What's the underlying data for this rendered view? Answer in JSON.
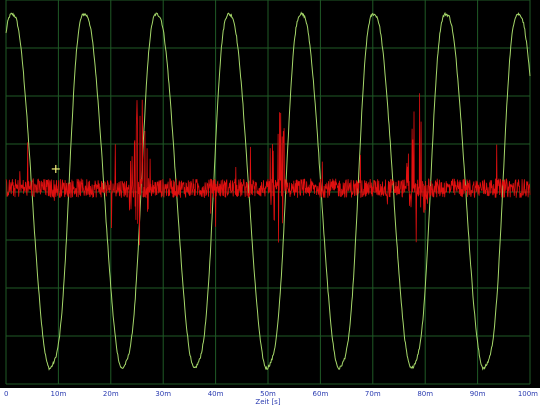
{
  "chart_data": {
    "type": "line",
    "background": "#000000",
    "grid": true,
    "grid_color": "#1f5a26",
    "xlabel": "Zeit [s]",
    "xlim": [
      0,
      0.1
    ],
    "x_tick_values": [
      0,
      0.01,
      0.02,
      0.03,
      0.04,
      0.05,
      0.06,
      0.07,
      0.08,
      0.09,
      0.1
    ],
    "x_tick_labels": [
      "0",
      "10m",
      "20m",
      "30m",
      "40m",
      "50m",
      "60m",
      "70m",
      "80m",
      "90m",
      "100m"
    ],
    "ylim": [
      -1.0,
      1.0
    ],
    "y_grid_lines": 8,
    "series": [
      {
        "color": "#a6d86a",
        "style": "sine-like",
        "period": 0.0138,
        "amplitude": 0.92,
        "phase_peak_at": 0.0015
      },
      {
        "color": "#e01010",
        "style": "noise with spike bursts",
        "baseline": 0.02,
        "noise_amplitude": 0.05,
        "burst_centers": [
          0.0255,
          0.052,
          0.0785
        ],
        "burst_peaks": [
          0.62,
          0.55,
          0.62
        ]
      }
    ],
    "cursor_marker": {
      "x": 0.0095,
      "y": 0.12,
      "color": "#f2f07a"
    }
  }
}
